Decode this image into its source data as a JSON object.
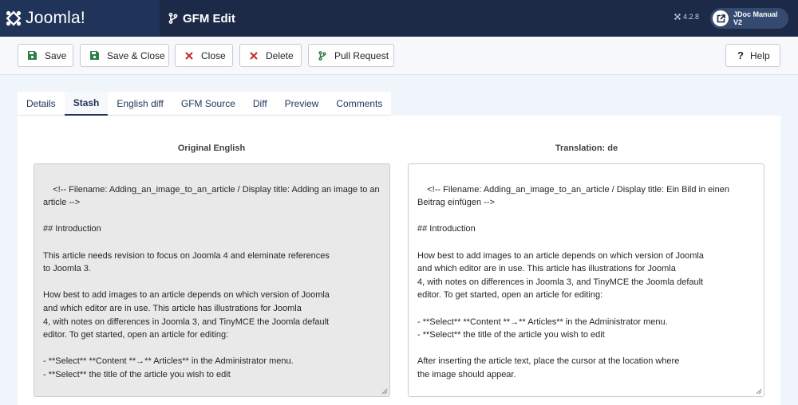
{
  "header": {
    "logo_text": "Joomla!",
    "title": "GFM Edit",
    "version": "4.2.8",
    "site_button": "JDoc Manual V2"
  },
  "toolbar": {
    "save": "Save",
    "save_close": "Save & Close",
    "close": "Close",
    "delete": "Delete",
    "pull_request": "Pull Request",
    "help": "Help"
  },
  "tabs": [
    "Details",
    "Stash",
    "English diff",
    "GFM Source",
    "Diff",
    "Preview",
    "Comments"
  ],
  "active_tab": "Stash",
  "original": {
    "title": "Original English",
    "text": "<!-- Filename: Adding_an_image_to_an_article / Display title: Adding an image to an article -->\n\n## Introduction\n\nThis article needs revision to focus on Joomla 4 and eleminate references\nto Joomla 3.\n\nHow best to add images to an article depends on which version of Joomla\nand which editor are in use. This article has illustrations for Joomla\n4, with notes on differences in Joomla 3, and TinyMCE the Joomla default\neditor. To get started, open an article for editing:\n\n- **Select** **Content **→** Articles** in the Administrator menu.\n- **Select** the title of the article you wish to edit\n\nAfter inserting the article text, place the cursor at the location where"
  },
  "translation": {
    "title": "Translation: de",
    "text": "<!-- Filename: Adding_an_image_to_an_article / Display title: Ein Bild in einen Beitrag einfügen -->\n\n## Introduction\n\nHow best to add images to an article depends on which version of Joomla\nand which editor are in use. This article has illustrations for Joomla\n4, with notes on differences in Joomla 3, and TinyMCE the Joomla default\neditor. To get started, open an article for editing:\n\n- **Select** **Content **→** Articles** in the Administrator menu.\n- **Select** the title of the article you wish to edit\n\nAfter inserting the article text, place the cursor at the location where\nthe image should appear.\n\n## Adding a local image"
  },
  "colors": {
    "header_bg": "#1c2a47",
    "logo_bg": "#1f3458",
    "save_green": "#2f7d4b",
    "danger_red": "#c52827",
    "link_blue": "#1f3458"
  },
  "icons": {
    "logo": "joomla-logo-icon",
    "title": "git-branch-icon",
    "version": "joomla-small-icon",
    "site": "external-link-icon",
    "save": "floppy-disk-icon",
    "close": "x-icon",
    "delete": "x-icon",
    "pull_request": "git-branch-icon",
    "help": "question-icon"
  }
}
